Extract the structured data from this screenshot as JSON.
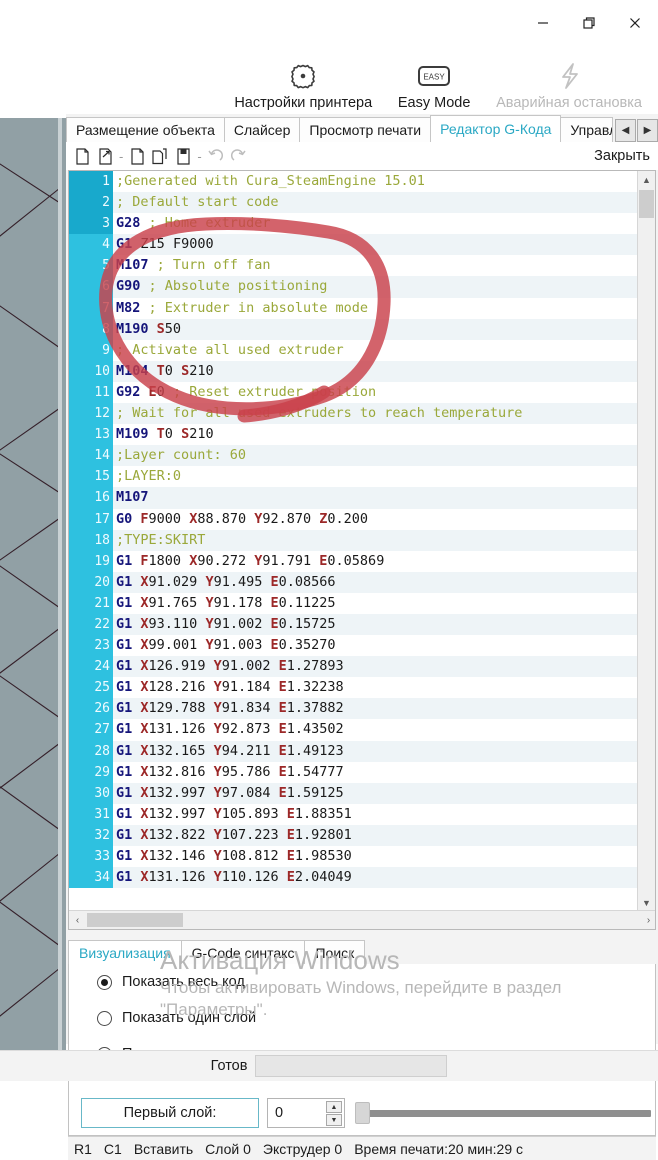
{
  "window": {
    "controls": [
      {
        "name": "minimize",
        "glyph": "minimize-icon"
      },
      {
        "name": "restore",
        "glyph": "restore-icon"
      },
      {
        "name": "close",
        "glyph": "close-icon"
      }
    ]
  },
  "ribbon": {
    "items": [
      {
        "label": "Настройки принтера",
        "icon": "gear-icon",
        "disabled": false
      },
      {
        "label": "Easy Mode",
        "icon": "easy-badge-icon",
        "badge_text": "EASY",
        "disabled": false
      },
      {
        "label": "Аварийная остановка",
        "icon": "lightning-bolt-icon",
        "disabled": true
      }
    ]
  },
  "tabs": {
    "items": [
      {
        "label": "Размещение объекта",
        "active": false
      },
      {
        "label": "Слайсер",
        "active": false
      },
      {
        "label": "Просмотр печати",
        "active": false
      },
      {
        "label": "Редактор G-Кода",
        "active": true
      },
      {
        "label": "Управл",
        "active": false,
        "clipped": true
      }
    ],
    "scroll_left": "◀",
    "scroll_right": "▶"
  },
  "editor_toolbar": {
    "buttons": [
      {
        "name": "new-file-icon"
      },
      {
        "name": "open-file-icon"
      },
      {
        "name": "separator"
      },
      {
        "name": "save-file-icon"
      },
      {
        "name": "save-as-file-icon"
      },
      {
        "name": "save-all-icon"
      },
      {
        "name": "separator"
      },
      {
        "name": "undo-icon"
      },
      {
        "name": "redo-icon"
      }
    ],
    "separator_glyph": "-",
    "close_label": "Закрыть"
  },
  "code": {
    "lines": [
      {
        "n": 1,
        "tokens": [
          {
            "t": ";Generated with Cura_SteamEngine 15.01",
            "c": "comment"
          }
        ]
      },
      {
        "n": 2,
        "tokens": [
          {
            "t": "; Default start code",
            "c": "comment"
          }
        ]
      },
      {
        "n": 3,
        "tokens": [
          {
            "t": "G28",
            "c": "g"
          },
          {
            "t": " ",
            "c": "plain"
          },
          {
            "t": "; Home extruder",
            "c": "comment"
          }
        ]
      },
      {
        "n": 4,
        "tokens": [
          {
            "t": "G1",
            "c": "g"
          },
          {
            "t": " ",
            "c": "plain"
          },
          {
            "t": "Z15",
            "c": "plain"
          },
          {
            "t": " ",
            "c": "plain"
          },
          {
            "t": "F9000",
            "c": "plain"
          }
        ]
      },
      {
        "n": 5,
        "tokens": [
          {
            "t": "M107",
            "c": "g"
          },
          {
            "t": " ",
            "c": "plain"
          },
          {
            "t": "; Turn off fan",
            "c": "comment"
          }
        ]
      },
      {
        "n": 6,
        "tokens": [
          {
            "t": "G90",
            "c": "g"
          },
          {
            "t": " ",
            "c": "plain"
          },
          {
            "t": "; Absolute positioning",
            "c": "comment"
          }
        ]
      },
      {
        "n": 7,
        "tokens": [
          {
            "t": "M82",
            "c": "g"
          },
          {
            "t": " ",
            "c": "plain"
          },
          {
            "t": "; Extruder in absolute mode",
            "c": "comment"
          }
        ]
      },
      {
        "n": 8,
        "tokens": [
          {
            "t": "M190",
            "c": "g"
          },
          {
            "t": " ",
            "c": "plain"
          },
          {
            "t": "S",
            "c": "param"
          },
          {
            "t": "50",
            "c": "plain"
          }
        ]
      },
      {
        "n": 9,
        "tokens": [
          {
            "t": "; Activate all used extruder",
            "c": "comment"
          }
        ]
      },
      {
        "n": 10,
        "tokens": [
          {
            "t": "M104",
            "c": "g"
          },
          {
            "t": " ",
            "c": "plain"
          },
          {
            "t": "T",
            "c": "param"
          },
          {
            "t": "0 ",
            "c": "plain"
          },
          {
            "t": "S",
            "c": "param"
          },
          {
            "t": "210",
            "c": "plain"
          }
        ]
      },
      {
        "n": 11,
        "tokens": [
          {
            "t": "G92",
            "c": "g"
          },
          {
            "t": " ",
            "c": "plain"
          },
          {
            "t": "E",
            "c": "param"
          },
          {
            "t": "0 ",
            "c": "plain"
          },
          {
            "t": "; Reset extruder position",
            "c": "comment"
          }
        ]
      },
      {
        "n": 12,
        "tokens": [
          {
            "t": "; Wait for all used extruders to reach temperature",
            "c": "comment"
          }
        ]
      },
      {
        "n": 13,
        "tokens": [
          {
            "t": "M109",
            "c": "g"
          },
          {
            "t": " ",
            "c": "plain"
          },
          {
            "t": "T",
            "c": "param"
          },
          {
            "t": "0 ",
            "c": "plain"
          },
          {
            "t": "S",
            "c": "param"
          },
          {
            "t": "210",
            "c": "plain"
          }
        ]
      },
      {
        "n": 14,
        "tokens": [
          {
            "t": ";Layer count: 60",
            "c": "comment"
          }
        ]
      },
      {
        "n": 15,
        "tokens": [
          {
            "t": ";LAYER:0",
            "c": "comment"
          }
        ]
      },
      {
        "n": 16,
        "tokens": [
          {
            "t": "M107",
            "c": "g"
          }
        ]
      },
      {
        "n": 17,
        "tokens": [
          {
            "t": "G0",
            "c": "g"
          },
          {
            "t": " ",
            "c": "plain"
          },
          {
            "t": "F",
            "c": "param"
          },
          {
            "t": "9000 ",
            "c": "plain"
          },
          {
            "t": "X",
            "c": "param"
          },
          {
            "t": "88.870 ",
            "c": "plain"
          },
          {
            "t": "Y",
            "c": "param"
          },
          {
            "t": "92.870 ",
            "c": "plain"
          },
          {
            "t": "Z",
            "c": "param"
          },
          {
            "t": "0.200",
            "c": "plain"
          }
        ]
      },
      {
        "n": 18,
        "tokens": [
          {
            "t": ";TYPE:SKIRT",
            "c": "comment"
          }
        ]
      },
      {
        "n": 19,
        "tokens": [
          {
            "t": "G1",
            "c": "g"
          },
          {
            "t": " ",
            "c": "plain"
          },
          {
            "t": "F",
            "c": "param"
          },
          {
            "t": "1800 ",
            "c": "plain"
          },
          {
            "t": "X",
            "c": "param"
          },
          {
            "t": "90.272 ",
            "c": "plain"
          },
          {
            "t": "Y",
            "c": "param"
          },
          {
            "t": "91.791 ",
            "c": "plain"
          },
          {
            "t": "E",
            "c": "param"
          },
          {
            "t": "0.05869",
            "c": "plain"
          }
        ]
      },
      {
        "n": 20,
        "tokens": [
          {
            "t": "G1",
            "c": "g"
          },
          {
            "t": " ",
            "c": "plain"
          },
          {
            "t": "X",
            "c": "param"
          },
          {
            "t": "91.029 ",
            "c": "plain"
          },
          {
            "t": "Y",
            "c": "param"
          },
          {
            "t": "91.495 ",
            "c": "plain"
          },
          {
            "t": "E",
            "c": "param"
          },
          {
            "t": "0.08566",
            "c": "plain"
          }
        ]
      },
      {
        "n": 21,
        "tokens": [
          {
            "t": "G1",
            "c": "g"
          },
          {
            "t": " ",
            "c": "plain"
          },
          {
            "t": "X",
            "c": "param"
          },
          {
            "t": "91.765 ",
            "c": "plain"
          },
          {
            "t": "Y",
            "c": "param"
          },
          {
            "t": "91.178 ",
            "c": "plain"
          },
          {
            "t": "E",
            "c": "param"
          },
          {
            "t": "0.11225",
            "c": "plain"
          }
        ]
      },
      {
        "n": 22,
        "tokens": [
          {
            "t": "G1",
            "c": "g"
          },
          {
            "t": " ",
            "c": "plain"
          },
          {
            "t": "X",
            "c": "param"
          },
          {
            "t": "93.110 ",
            "c": "plain"
          },
          {
            "t": "Y",
            "c": "param"
          },
          {
            "t": "91.002 ",
            "c": "plain"
          },
          {
            "t": "E",
            "c": "param"
          },
          {
            "t": "0.15725",
            "c": "plain"
          }
        ]
      },
      {
        "n": 23,
        "tokens": [
          {
            "t": "G1",
            "c": "g"
          },
          {
            "t": " ",
            "c": "plain"
          },
          {
            "t": "X",
            "c": "param"
          },
          {
            "t": "99.001 ",
            "c": "plain"
          },
          {
            "t": "Y",
            "c": "param"
          },
          {
            "t": "91.003 ",
            "c": "plain"
          },
          {
            "t": "E",
            "c": "param"
          },
          {
            "t": "0.35270",
            "c": "plain"
          }
        ]
      },
      {
        "n": 24,
        "tokens": [
          {
            "t": "G1",
            "c": "g"
          },
          {
            "t": " ",
            "c": "plain"
          },
          {
            "t": "X",
            "c": "param"
          },
          {
            "t": "126.919 ",
            "c": "plain"
          },
          {
            "t": "Y",
            "c": "param"
          },
          {
            "t": "91.002 ",
            "c": "plain"
          },
          {
            "t": "E",
            "c": "param"
          },
          {
            "t": "1.27893",
            "c": "plain"
          }
        ]
      },
      {
        "n": 25,
        "tokens": [
          {
            "t": "G1",
            "c": "g"
          },
          {
            "t": " ",
            "c": "plain"
          },
          {
            "t": "X",
            "c": "param"
          },
          {
            "t": "128.216 ",
            "c": "plain"
          },
          {
            "t": "Y",
            "c": "param"
          },
          {
            "t": "91.184 ",
            "c": "plain"
          },
          {
            "t": "E",
            "c": "param"
          },
          {
            "t": "1.32238",
            "c": "plain"
          }
        ]
      },
      {
        "n": 26,
        "tokens": [
          {
            "t": "G1",
            "c": "g"
          },
          {
            "t": " ",
            "c": "plain"
          },
          {
            "t": "X",
            "c": "param"
          },
          {
            "t": "129.788 ",
            "c": "plain"
          },
          {
            "t": "Y",
            "c": "param"
          },
          {
            "t": "91.834 ",
            "c": "plain"
          },
          {
            "t": "E",
            "c": "param"
          },
          {
            "t": "1.37882",
            "c": "plain"
          }
        ]
      },
      {
        "n": 27,
        "tokens": [
          {
            "t": "G1",
            "c": "g"
          },
          {
            "t": " ",
            "c": "plain"
          },
          {
            "t": "X",
            "c": "param"
          },
          {
            "t": "131.126 ",
            "c": "plain"
          },
          {
            "t": "Y",
            "c": "param"
          },
          {
            "t": "92.873 ",
            "c": "plain"
          },
          {
            "t": "E",
            "c": "param"
          },
          {
            "t": "1.43502",
            "c": "plain"
          }
        ]
      },
      {
        "n": 28,
        "tokens": [
          {
            "t": "G1",
            "c": "g"
          },
          {
            "t": " ",
            "c": "plain"
          },
          {
            "t": "X",
            "c": "param"
          },
          {
            "t": "132.165 ",
            "c": "plain"
          },
          {
            "t": "Y",
            "c": "param"
          },
          {
            "t": "94.211 ",
            "c": "plain"
          },
          {
            "t": "E",
            "c": "param"
          },
          {
            "t": "1.49123",
            "c": "plain"
          }
        ]
      },
      {
        "n": 29,
        "tokens": [
          {
            "t": "G1",
            "c": "g"
          },
          {
            "t": " ",
            "c": "plain"
          },
          {
            "t": "X",
            "c": "param"
          },
          {
            "t": "132.816 ",
            "c": "plain"
          },
          {
            "t": "Y",
            "c": "param"
          },
          {
            "t": "95.786 ",
            "c": "plain"
          },
          {
            "t": "E",
            "c": "param"
          },
          {
            "t": "1.54777",
            "c": "plain"
          }
        ]
      },
      {
        "n": 30,
        "tokens": [
          {
            "t": "G1",
            "c": "g"
          },
          {
            "t": " ",
            "c": "plain"
          },
          {
            "t": "X",
            "c": "param"
          },
          {
            "t": "132.997 ",
            "c": "plain"
          },
          {
            "t": "Y",
            "c": "param"
          },
          {
            "t": "97.084 ",
            "c": "plain"
          },
          {
            "t": "E",
            "c": "param"
          },
          {
            "t": "1.59125",
            "c": "plain"
          }
        ]
      },
      {
        "n": 31,
        "tokens": [
          {
            "t": "G1",
            "c": "g"
          },
          {
            "t": " ",
            "c": "plain"
          },
          {
            "t": "X",
            "c": "param"
          },
          {
            "t": "132.997 ",
            "c": "plain"
          },
          {
            "t": "Y",
            "c": "param"
          },
          {
            "t": "105.893 ",
            "c": "plain"
          },
          {
            "t": "E",
            "c": "param"
          },
          {
            "t": "1.88351",
            "c": "plain"
          }
        ]
      },
      {
        "n": 32,
        "tokens": [
          {
            "t": "G1",
            "c": "g"
          },
          {
            "t": " ",
            "c": "plain"
          },
          {
            "t": "X",
            "c": "param"
          },
          {
            "t": "132.822 ",
            "c": "plain"
          },
          {
            "t": "Y",
            "c": "param"
          },
          {
            "t": "107.223 ",
            "c": "plain"
          },
          {
            "t": "E",
            "c": "param"
          },
          {
            "t": "1.92801",
            "c": "plain"
          }
        ]
      },
      {
        "n": 33,
        "tokens": [
          {
            "t": "G1",
            "c": "g"
          },
          {
            "t": " ",
            "c": "plain"
          },
          {
            "t": "X",
            "c": "param"
          },
          {
            "t": "132.146 ",
            "c": "plain"
          },
          {
            "t": "Y",
            "c": "param"
          },
          {
            "t": "108.812 ",
            "c": "plain"
          },
          {
            "t": "E",
            "c": "param"
          },
          {
            "t": "1.98530",
            "c": "plain"
          }
        ]
      },
      {
        "n": 34,
        "tokens": [
          {
            "t": "G1",
            "c": "g"
          },
          {
            "t": " ",
            "c": "plain"
          },
          {
            "t": "X",
            "c": "param"
          },
          {
            "t": "131.126 ",
            "c": "plain"
          },
          {
            "t": "Y",
            "c": "param"
          },
          {
            "t": "110.126 ",
            "c": "plain"
          },
          {
            "t": "E",
            "c": "param"
          },
          {
            "t": "2.04049",
            "c": "plain"
          }
        ]
      }
    ]
  },
  "bottom_tabs": {
    "items": [
      {
        "label": "Визуализация",
        "active": true
      },
      {
        "label": "G-Code синтакс",
        "active": false
      },
      {
        "label": "Поиск",
        "active": false
      }
    ]
  },
  "visualization": {
    "radios": [
      {
        "label": "Показать весь код",
        "selected": true
      },
      {
        "label": "Показать один слой",
        "selected": false
      },
      {
        "label": "Показать диапазон слоев",
        "selected": false
      }
    ],
    "first_layer_label": "Первый слой:",
    "first_layer_value": "0"
  },
  "status": {
    "items": [
      "R1",
      "C1",
      "Вставить",
      "Слой 0",
      "Экструдер 0",
      "Время печати:20 мин:29 с"
    ]
  },
  "app_status": {
    "label": "Готов"
  },
  "watermark": {
    "line1": "Активация Windows",
    "line2": "Чтобы активировать Windows, перейдите в раздел \"Параметры\"."
  },
  "colors": {
    "accent": "#2aa8c4",
    "gutter": "#2ec1e0",
    "gutter_selected": "#18a9cc",
    "annotation": "#c9414a",
    "comment": "#9aa83a",
    "gcode": "#15157a",
    "param": "#9c2828",
    "viewport_bg": "#91a0a5"
  }
}
